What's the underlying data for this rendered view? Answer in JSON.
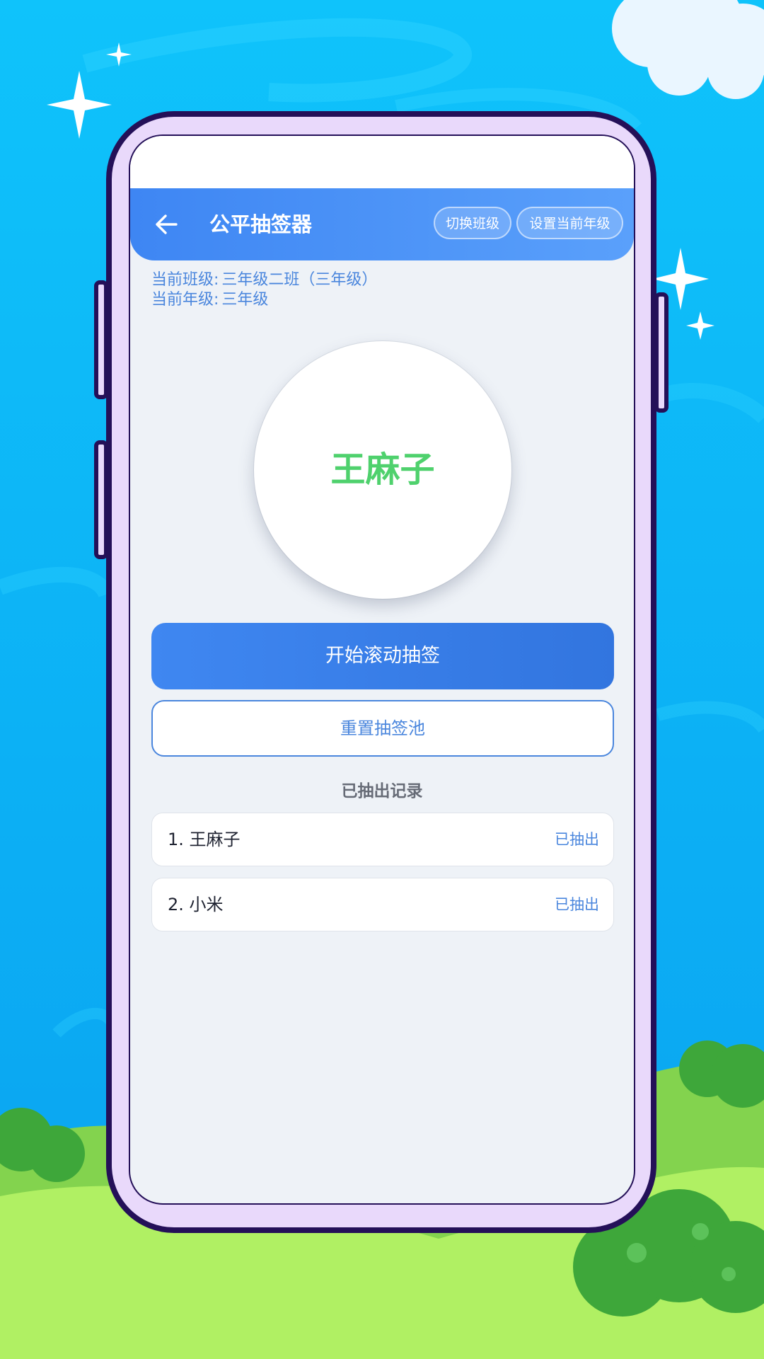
{
  "header": {
    "title": "公平抽签器",
    "switch_class_label": "切换班级",
    "set_grade_label": "设置当前年级"
  },
  "info": {
    "class_label": "当前班级:",
    "class_value": "三年级二班（三年级）",
    "grade_label": "当前年级:",
    "grade_value": "三年级"
  },
  "result": {
    "name": "王麻子"
  },
  "actions": {
    "start_label": "开始滚动抽签",
    "reset_label": "重置抽签池"
  },
  "records": {
    "title": "已抽出记录",
    "items": [
      {
        "name": "1. 王麻子",
        "status": "已抽出"
      },
      {
        "name": "2. 小米",
        "status": "已抽出"
      }
    ]
  },
  "colors": {
    "accent": "#3f87f1",
    "result_text": "#4fd16d",
    "sky": "#10b6f4",
    "grass": "#a8e85a",
    "frame": "#e9d9fb"
  }
}
